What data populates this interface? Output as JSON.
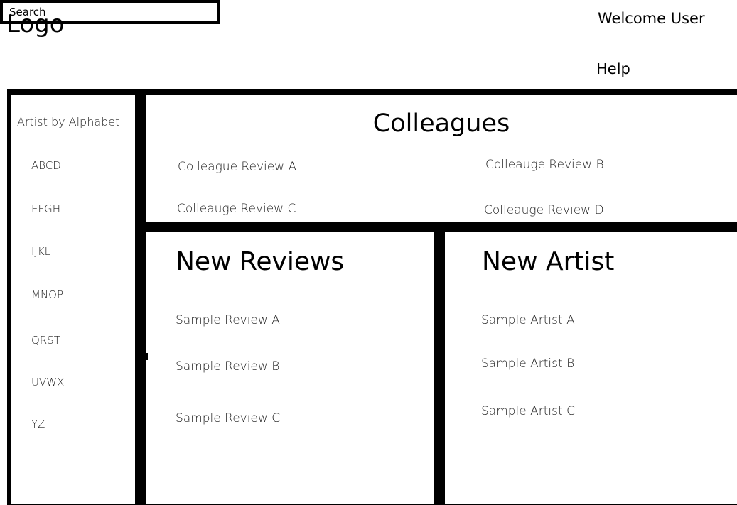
{
  "header": {
    "logo": "Logo",
    "search_placeholder": "Search",
    "welcome": "Welcome User",
    "help": "Help"
  },
  "sidebar": {
    "title": "Artist by Alphabet",
    "letters": [
      "ABCD",
      "EFGH",
      "IJKL",
      "MNOP",
      "QRST",
      "UVWX",
      "YZ"
    ]
  },
  "colleagues": {
    "title": "Colleagues",
    "items": [
      "Colleague Review A",
      "Colleauge Review B",
      "Colleauge Review C",
      "Colleauge Review D"
    ]
  },
  "new_reviews": {
    "title": "New Reviews",
    "items": [
      "Sample Review A",
      "Sample Review B",
      "Sample Review C"
    ]
  },
  "new_artist": {
    "title": "New Artist",
    "items": [
      "Sample Artist A",
      "Sample Artist B",
      "Sample Artist C"
    ]
  }
}
